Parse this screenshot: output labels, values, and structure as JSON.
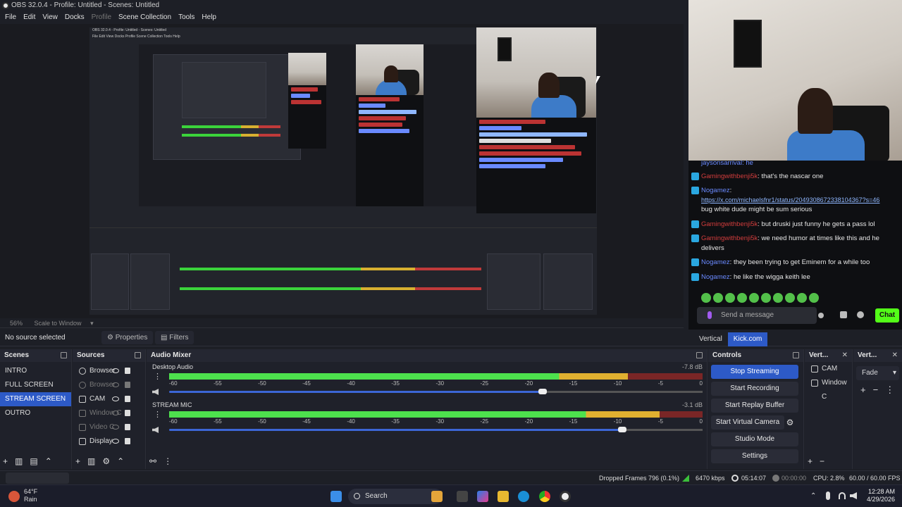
{
  "window": {
    "title": "OBS 32.0.4 - Profile: Untitled - Scenes: Untitled"
  },
  "menu": [
    "File",
    "Edit",
    "View",
    "Docks",
    "Profile",
    "Scene Collection",
    "Tools",
    "Help"
  ],
  "preview": {
    "zoom": "56%",
    "scale_mode": "Scale to Window",
    "inner_title": "OBS 32.0.4 - Profile: Untitled - Scenes: Untitled",
    "inner_menu": "File  Edit  View  Docks  Profile  Scene Collection  Tools  Help"
  },
  "source_toolbar": {
    "no_source": "No source selected",
    "properties": "Properties",
    "filters": "Filters"
  },
  "chat": {
    "top_partial": "jaysonsarrival: he",
    "messages": [
      {
        "user": "Gamingwithbenji5k",
        "sep": ":",
        "text": " that's the nascar one"
      },
      {
        "user": "Nogamez",
        "sep": ":",
        "text": ""
      },
      {
        "link": "https://x.com/michaelsfnr1/status/2049308672338104367?s=46"
      },
      {
        "plain": "bug white dude might be sum serious"
      },
      {
        "user": "Gamingwithbenji5k",
        "sep": ":",
        "text": " but druski just funny he gets a pass lol"
      },
      {
        "user": "Gamingwithbenji5k",
        "sep": ":",
        "text": " we need humor at times like this and he"
      },
      {
        "plain": "delivers"
      },
      {
        "user": "Nogamez",
        "sep": ":",
        "text": " they been trying to get Eminem for a while too"
      },
      {
        "user": "Nogamez",
        "sep": ":",
        "text": " he like the wigga keith lee"
      }
    ],
    "input_placeholder": "Send a message",
    "chat_button": "Chat"
  },
  "dock_tabs": [
    "Vertical",
    "Kick.com"
  ],
  "scenes": {
    "title": "Scenes",
    "items": [
      "INTRO",
      "FULL SCREEN",
      "STREAM SCREEN",
      "OUTRO"
    ],
    "selected": "STREAM SCREEN"
  },
  "sources": {
    "title": "Sources",
    "items": [
      {
        "name": "Browser",
        "icon": "browser-icon",
        "dim": false
      },
      {
        "name": "Browser",
        "icon": "browser-icon",
        "dim": true
      },
      {
        "name": "CAM",
        "icon": "camera-icon",
        "dim": false
      },
      {
        "name": "Window C",
        "icon": "window-icon",
        "dim": true
      },
      {
        "name": "Video C",
        "icon": "video-icon",
        "dim": true
      },
      {
        "name": "Display",
        "icon": "display-icon",
        "dim": false
      }
    ]
  },
  "mixer": {
    "title": "Audio Mixer",
    "scale": [
      "-60",
      "-55",
      "-50",
      "-45",
      "-40",
      "-35",
      "-30",
      "-25",
      "-20",
      "-15",
      "-10",
      "-5",
      "0"
    ],
    "channels": [
      {
        "name": "Desktop Audio",
        "db": "-7.8 dB",
        "level": 0.86,
        "volume": 0.7
      },
      {
        "name": "STREAM MIC",
        "db": "-3.1 dB",
        "level": 0.92,
        "volume": 0.85
      }
    ]
  },
  "controls": {
    "title": "Controls",
    "buttons": [
      "Stop Streaming",
      "Start Recording",
      "Start Replay Buffer",
      "Start Virtual Camera",
      "Studio Mode",
      "Settings"
    ]
  },
  "vert1": {
    "title": "Vert...",
    "items": [
      "CAM",
      "Window C"
    ]
  },
  "vert2": {
    "title": "Vert...",
    "transition": "Fade"
  },
  "status": {
    "dropped": "Dropped Frames 796 (0.1%)",
    "bitrate": "6470 kbps",
    "stream_time": "05:14:07",
    "rec_time": "00:00:00",
    "cpu": "CPU: 2.8%",
    "fps": "60.00 / 60.00 FPS"
  },
  "taskbar": {
    "temp": "64°F",
    "weather": "Rain",
    "search": "Search",
    "time": "12:28 AM",
    "date": "4/29/2026"
  },
  "colors": {
    "accent": "#2d5ac7",
    "kick_green": "#53fc18",
    "chat_user_red": "#d23c3c",
    "chat_user_blue": "#6a8aff"
  }
}
